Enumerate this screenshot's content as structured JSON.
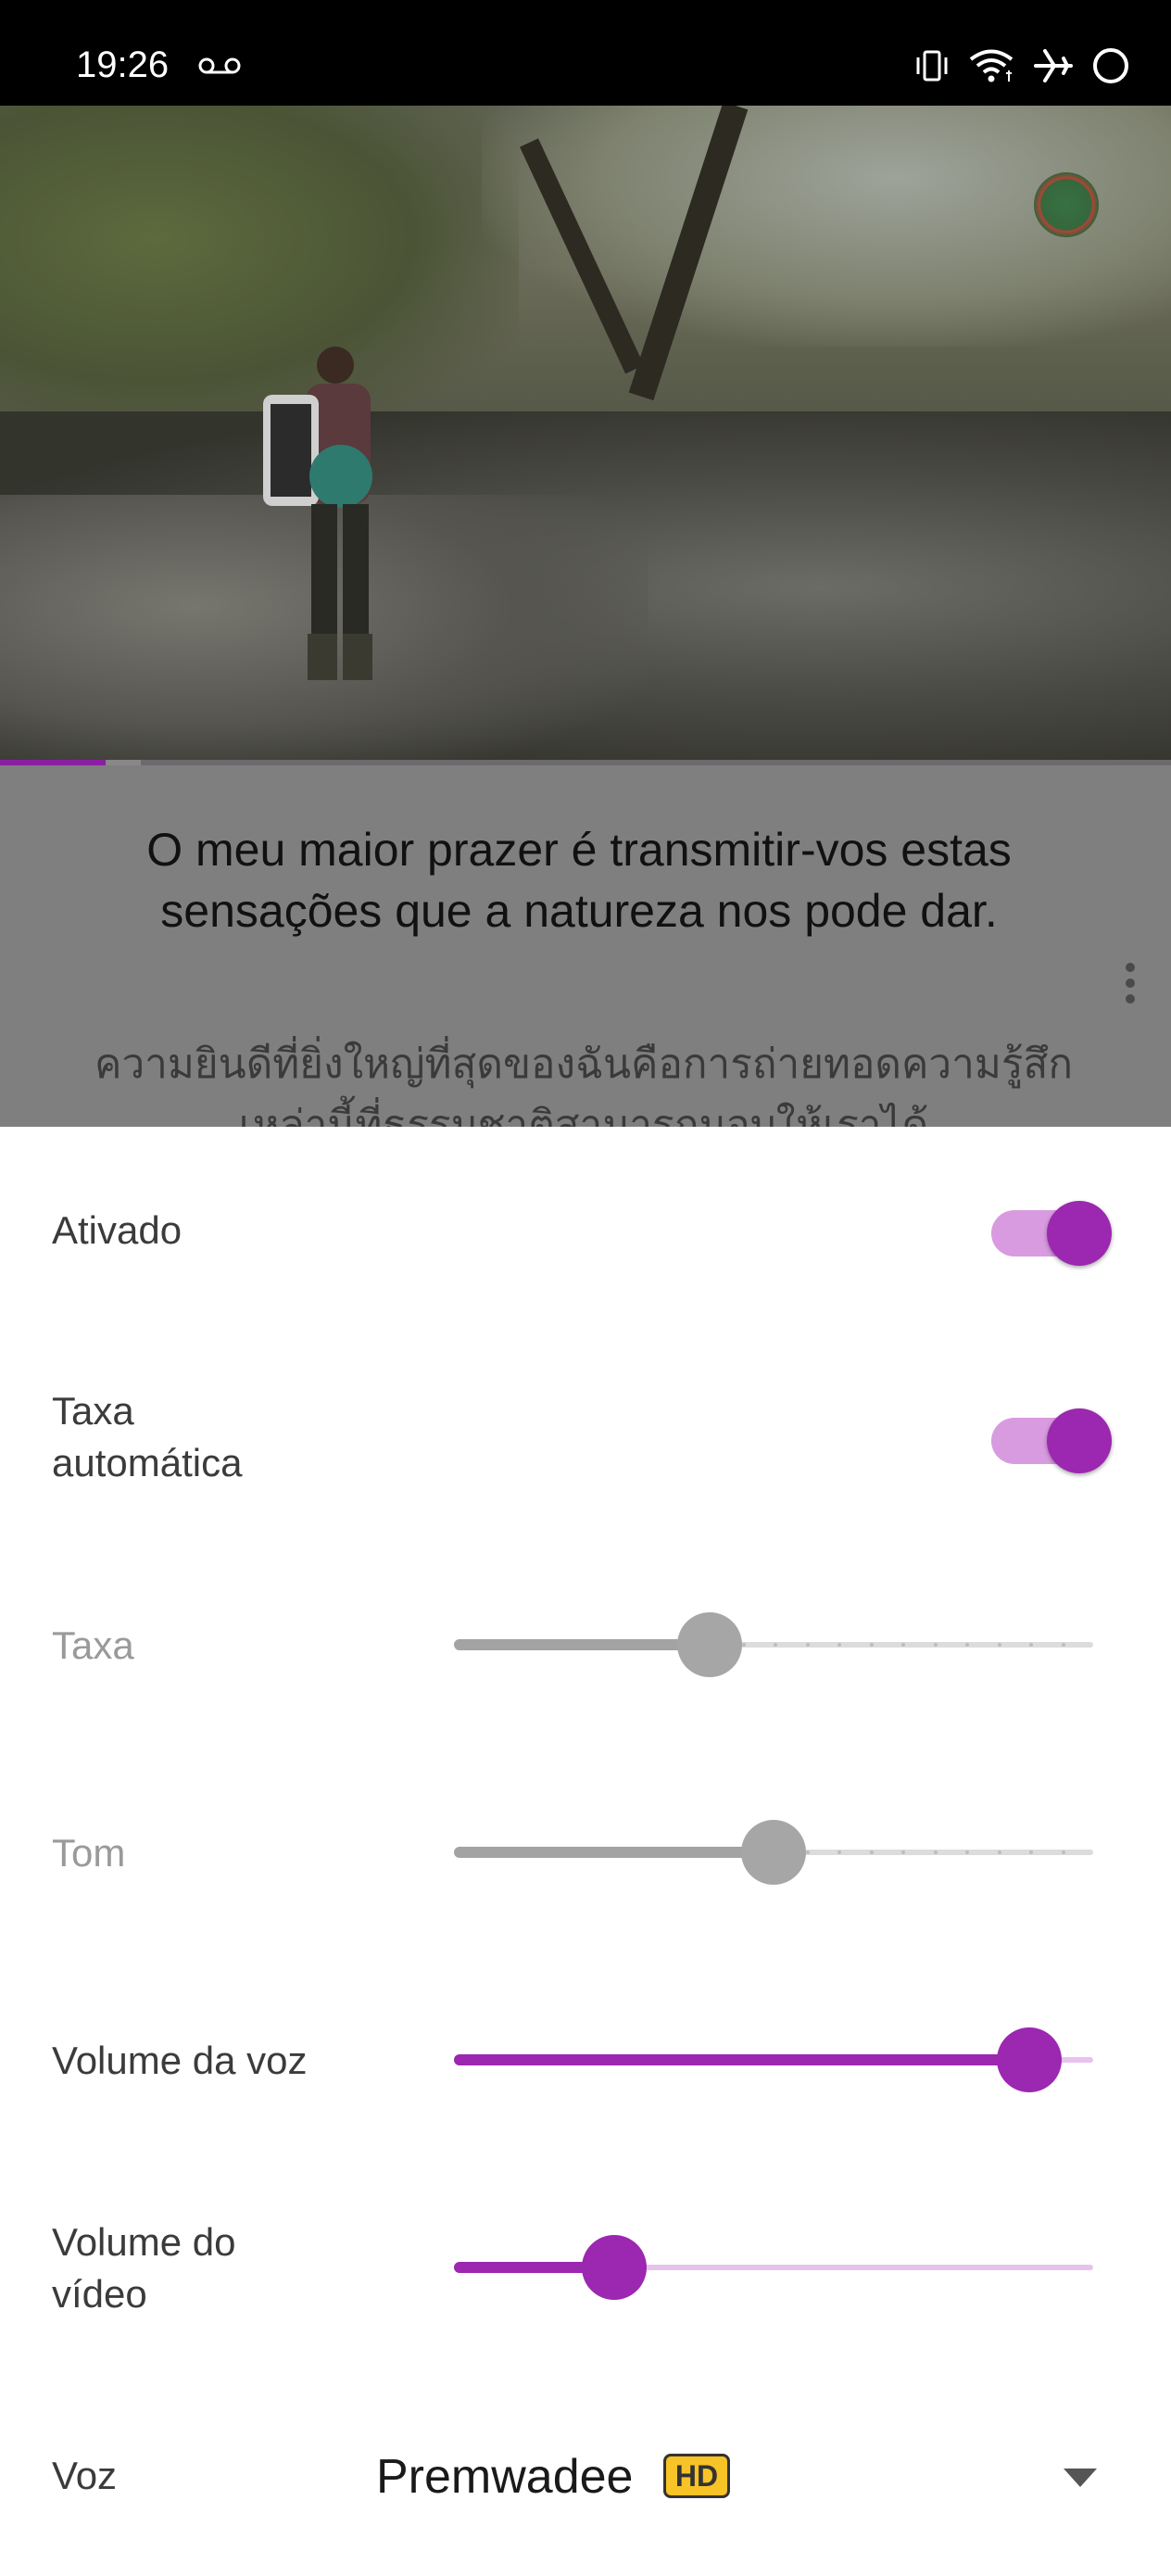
{
  "status_bar": {
    "time": "19:26",
    "icons": [
      "voicemail-icon",
      "vibrate-icon",
      "wifi-icon",
      "airplane-mode-icon",
      "circle-status-icon"
    ]
  },
  "video": {
    "progress_fraction": 0.09,
    "buffer_fraction": 0.12
  },
  "subtitles": {
    "primary": "O meu maior prazer é transmitir-vos estas sensações que a natureza nos pode dar.",
    "secondary": "ความยินดีที่ยิ่งใหญ่ที่สุดของฉันคือการถ่ายทอดความรู้สึกเหล่านี้ที่ธรรมชาติสามารถมอบให้เราได้"
  },
  "settings": {
    "enabled": {
      "label": "Ativado",
      "on": true
    },
    "auto_rate": {
      "label": "Taxa automática",
      "line1": "Taxa",
      "line2": "automática",
      "on": true
    },
    "rate": {
      "label": "Taxa",
      "value": 0.4,
      "disabled": true
    },
    "pitch": {
      "label": "Tom",
      "value": 0.5,
      "disabled": true
    },
    "voice_volume": {
      "label": "Volume da voz",
      "value": 0.9
    },
    "video_volume": {
      "label": "Volume do vídeo",
      "line1": "Volume do",
      "line2": "vídeo",
      "value": 0.25
    },
    "voice": {
      "label": "Voz",
      "value": "Premwadee",
      "badge": "HD"
    }
  },
  "colors": {
    "accent": "#9c27b0",
    "accent_light": "#d89be0",
    "disabled": "#a6a6a6"
  }
}
